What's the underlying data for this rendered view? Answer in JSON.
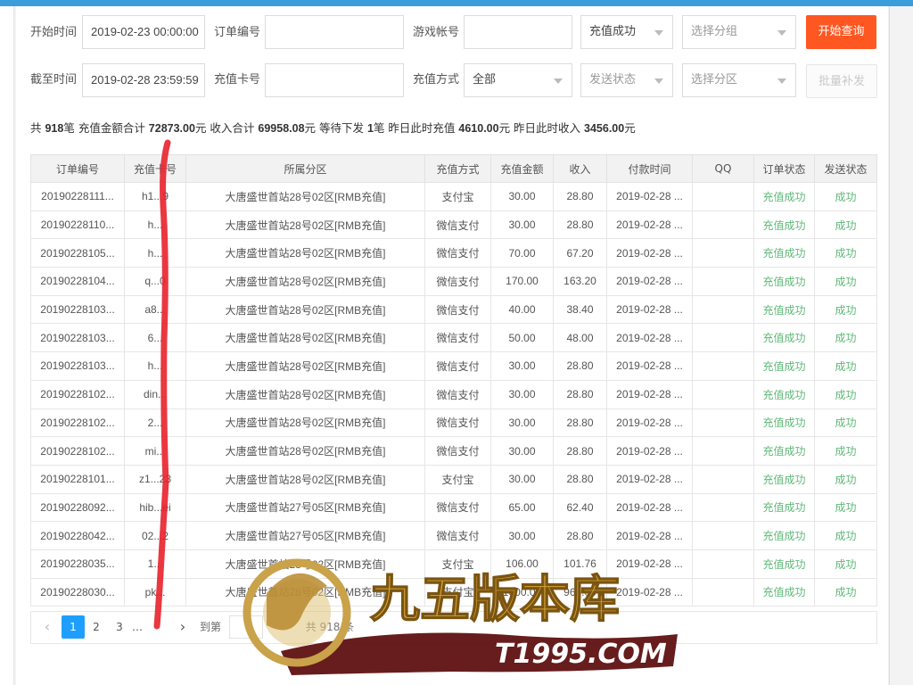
{
  "filters": {
    "start_label": "开始时间",
    "start_value": "2019-02-23 00:00:00",
    "end_label": "截至时间",
    "end_value": "2019-02-28 23:59:59",
    "order_no_label": "订单编号",
    "order_no_value": "",
    "card_no_label": "充值卡号",
    "card_no_value": "",
    "account_label": "游戏帐号",
    "account_value": "",
    "method_label": "充值方式",
    "method_value": "全部",
    "status_value": "充值成功",
    "send_status_placeholder": "发送状态",
    "group_placeholder": "选择分组",
    "zone_placeholder": "选择分区"
  },
  "buttons": {
    "query": "开始查询",
    "batch_resend": "批量补发"
  },
  "summary": {
    "t1": "共 ",
    "count": "918",
    "t2": "笔 充值金额合计 ",
    "total_amount": "72873.00",
    "t3": "元 收入合计 ",
    "total_income": "69958.08",
    "t4": "元 等待下发 ",
    "pending": "1",
    "t5": "笔 昨日此时充值 ",
    "yesterday_recharge": "4610.00",
    "t6": "元 昨日此时收入 ",
    "yesterday_income": "3456.00",
    "t7": "元"
  },
  "table": {
    "headers": [
      "订单编号",
      "充值卡号",
      "所属分区",
      "充值方式",
      "充值金额",
      "收入",
      "付款时间",
      "QQ",
      "订单状态",
      "发送状态"
    ],
    "rows": [
      [
        "20190228111...",
        "h1...9",
        "大唐盛世首站28号02区[RMB充值]",
        "支付宝",
        "30.00",
        "28.80",
        "2019-02-28 ...",
        "",
        "充值成功",
        "成功"
      ],
      [
        "20190228110...",
        "h...",
        "大唐盛世首站28号02区[RMB充值]",
        "微信支付",
        "30.00",
        "28.80",
        "2019-02-28 ...",
        "",
        "充值成功",
        "成功"
      ],
      [
        "20190228105...",
        "h...",
        "大唐盛世首站28号02区[RMB充值]",
        "微信支付",
        "70.00",
        "67.20",
        "2019-02-28 ...",
        "",
        "充值成功",
        "成功"
      ],
      [
        "20190228104...",
        "q...0",
        "大唐盛世首站28号02区[RMB充值]",
        "微信支付",
        "170.00",
        "163.20",
        "2019-02-28 ...",
        "",
        "充值成功",
        "成功"
      ],
      [
        "20190228103...",
        "a8...",
        "大唐盛世首站28号02区[RMB充值]",
        "微信支付",
        "40.00",
        "38.40",
        "2019-02-28 ...",
        "",
        "充值成功",
        "成功"
      ],
      [
        "20190228103...",
        "6...",
        "大唐盛世首站28号02区[RMB充值]",
        "微信支付",
        "50.00",
        "48.00",
        "2019-02-28 ...",
        "",
        "充值成功",
        "成功"
      ],
      [
        "20190228103...",
        "h...",
        "大唐盛世首站28号02区[RMB充值]",
        "微信支付",
        "30.00",
        "28.80",
        "2019-02-28 ...",
        "",
        "充值成功",
        "成功"
      ],
      [
        "20190228102...",
        "din...",
        "大唐盛世首站28号02区[RMB充值]",
        "微信支付",
        "30.00",
        "28.80",
        "2019-02-28 ...",
        "",
        "充值成功",
        "成功"
      ],
      [
        "20190228102...",
        "2...",
        "大唐盛世首站28号02区[RMB充值]",
        "微信支付",
        "30.00",
        "28.80",
        "2019-02-28 ...",
        "",
        "充值成功",
        "成功"
      ],
      [
        "20190228102...",
        "mi...",
        "大唐盛世首站28号02区[RMB充值]",
        "微信支付",
        "30.00",
        "28.80",
        "2019-02-28 ...",
        "",
        "充值成功",
        "成功"
      ],
      [
        "20190228101...",
        "z1...23",
        "大唐盛世首站28号02区[RMB充值]",
        "支付宝",
        "30.00",
        "28.80",
        "2019-02-28 ...",
        "",
        "充值成功",
        "成功"
      ],
      [
        "20190228092...",
        "hib...ei",
        "大唐盛世首站27号05区[RMB充值]",
        "微信支付",
        "65.00",
        "62.40",
        "2019-02-28 ...",
        "",
        "充值成功",
        "成功"
      ],
      [
        "20190228042...",
        "02...2",
        "大唐盛世首站27号05区[RMB充值]",
        "微信支付",
        "30.00",
        "28.80",
        "2019-02-28 ...",
        "",
        "充值成功",
        "成功"
      ],
      [
        "20190228035...",
        "1...",
        "大唐盛世首站28号02区[RMB充值]",
        "支付宝",
        "106.00",
        "101.76",
        "2019-02-28 ...",
        "",
        "充值成功",
        "成功"
      ],
      [
        "20190228030...",
        "pk...",
        "大唐盛世首站28号02区[RMB充值]",
        "支付宝",
        "1000.00",
        "960.00",
        "2019-02-28 ...",
        "",
        "充值成功",
        "成功"
      ]
    ]
  },
  "pagination": {
    "prev": "‹",
    "pages": [
      "1",
      "2",
      "3"
    ],
    "ellipsis": "…",
    "next": "›",
    "goto_label": "到第",
    "total_text": "共 918 条"
  },
  "watermark": {
    "brand_cn": "九五版本库",
    "domain": "T1995.COM"
  },
  "colors": {
    "accent_orange": "#ff5722",
    "top_bar": "#3c9ddc",
    "success_green": "#5fb878",
    "page_active": "#1e9fff",
    "annotation_red": "#e8212b"
  }
}
